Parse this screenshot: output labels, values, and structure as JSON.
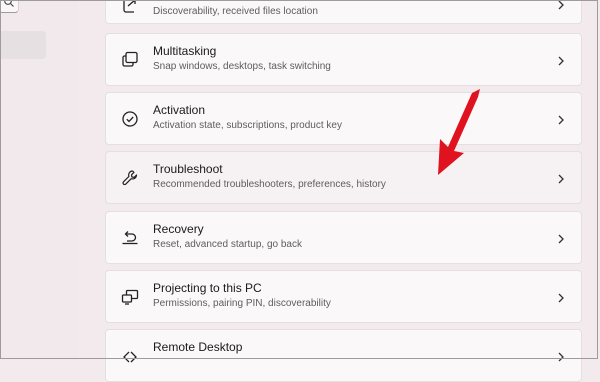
{
  "cards": [
    {
      "title": "",
      "subtitle": "Discoverability, received files location",
      "icon": "share-icon"
    },
    {
      "title": "Multitasking",
      "subtitle": "Snap windows, desktops, task switching",
      "icon": "multitasking-icon"
    },
    {
      "title": "Activation",
      "subtitle": "Activation state, subscriptions, product key",
      "icon": "activation-check-icon"
    },
    {
      "title": "Troubleshoot",
      "subtitle": "Recommended troubleshooters, preferences, history",
      "icon": "wrench-icon"
    },
    {
      "title": "Recovery",
      "subtitle": "Reset, advanced startup, go back",
      "icon": "recovery-icon"
    },
    {
      "title": "Projecting to this PC",
      "subtitle": "Permissions, pairing PIN, discoverability",
      "icon": "projecting-icon"
    },
    {
      "title": "Remote Desktop",
      "subtitle": "",
      "icon": "remote-desktop-icon"
    }
  ],
  "annotation": {
    "color": "#e0121f",
    "points_to": "Troubleshoot"
  },
  "theme": {
    "background": "#f2eaec",
    "card": "#fbf8f9",
    "hover_card": "#f6f1f3"
  }
}
